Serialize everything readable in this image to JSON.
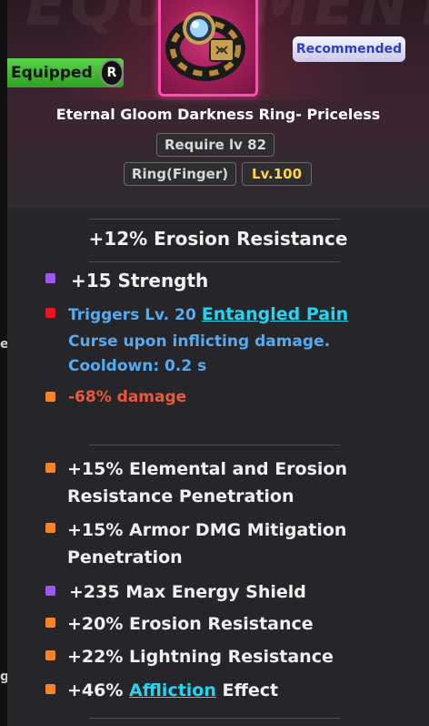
{
  "header": {
    "watermark": "EQUIPMENT",
    "recommended_label": "Recommended",
    "equipped_label": "Equipped",
    "equipped_badge": "R",
    "item_title": "Eternal Gloom Darkness Ring- Priceless",
    "require_label": "Require lv 82",
    "slot_label": "Ring(Finger)",
    "level_label": "Lv.100"
  },
  "base_stat": "+12% Erosion Resistance",
  "affixes_top": [
    {
      "text": "+15 Strength",
      "color": "#9b59f0"
    },
    {
      "prefix": "Triggers Lv. 20 ",
      "link": "Entangled Pain",
      "line2": "Curse upon inflicting damage.",
      "line3": "Cooldown: 0.2 s",
      "color": "#e8161e"
    },
    {
      "text": "-68% damage",
      "color": "#f3852b"
    }
  ],
  "affixes_bottom": [
    {
      "line1": "+15% Elemental and Erosion",
      "line2": "Resistance Penetration",
      "color": "#f3852b"
    },
    {
      "line1": "+15% Armor DMG Mitigation",
      "line2": "Penetration",
      "color": "#f3852b"
    },
    {
      "text": "+235 Max Energy Shield",
      "color": "#9b59f0"
    },
    {
      "text": "+20% Erosion Resistance",
      "color": "#f3852b"
    },
    {
      "text": "+22% Lightning Resistance",
      "color": "#f3852b"
    },
    {
      "prefix": "+46% ",
      "link": "Affliction",
      "suffix": " Effect",
      "color": "#f3852b"
    }
  ],
  "side_glyphs": {
    "a": "e",
    "b": "g"
  }
}
